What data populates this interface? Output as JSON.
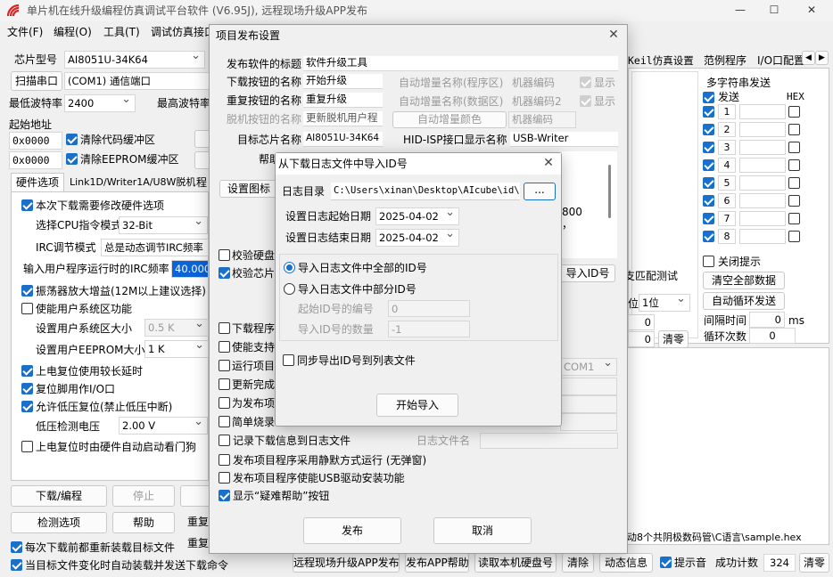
{
  "window": {
    "title": "单片机在线升级编程仿真调试平台软件 (V6.95J), 远程现场升级APP发布"
  },
  "menu": [
    "文件(F)",
    "编程(O)",
    "工具(T)",
    "调试仿真接口"
  ],
  "left": {
    "chip_label": "芯片型号",
    "chip_value": "AI8051U-34K64",
    "scan_btn": "扫描串口",
    "port_value": "(COM1) 通信端口",
    "min_baud_label": "最低波特率",
    "min_baud_value": "2400",
    "max_baud_label": "最高波特率",
    "start_addr_label": "起始地址",
    "addr1": "0x0000",
    "clear_code": "清除代码缓冲区",
    "addr2": "0x0000",
    "clear_eeprom": "清除EEPROM缓冲区",
    "tabs": [
      "硬件选项",
      "Link1D/Writer1A/U8W脱机",
      "程"
    ],
    "opt_modify_hw": "本次下载需要修改硬件选项",
    "cpu_mode_label": "选择CPU指令模式",
    "cpu_mode_value": "32-Bit",
    "irc_label": "IRC调节模式",
    "irc_value": "总是动态调节IRC频率",
    "irc_input_label": "输入用户程序运行时的IRC频率",
    "irc_input_value": "40.000",
    "osc_gain": "振荡器放大增益(12M以上建议选择)",
    "sys_area": "使能用户系统区功能",
    "sys_size_label": "设置用户系统区大小",
    "sys_size_value": "0.5 K",
    "eeprom_size_label": "设置用户EEPROM大小",
    "eeprom_size_value": "1 K",
    "long_delay": "上电复位使用较长延时",
    "reset_io": "复位脚用作I/O口",
    "lvd_reset": "允许低压复位(禁止低压中断)",
    "lvd_label": "低压检测电压",
    "lvd_value": "2.00 V",
    "wdt": "上电复位时由硬件自动启动看门狗",
    "download_btn": "下载/编程",
    "stop_btn": "停止",
    "check_btn": "检测选项",
    "help_btn": "帮助",
    "reload_each": "每次下载前都重新装载目标文件",
    "auto_reload": "当目标文件变化时自动装载并发送下载命令",
    "repeat1": "重复",
    "repeat2": "重复"
  },
  "right": {
    "tabs": [
      "Keil仿真设置",
      "范例程序",
      "I/O口配置"
    ],
    "serial_title": "多字符串发送",
    "send_header": "发送",
    "hex_header": "HEX",
    "rows": [
      "1",
      "2",
      "3",
      "4",
      "5",
      "6",
      "7",
      "8"
    ],
    "close_tip": "关闭提示",
    "clear_all_btn": "清空全部数据",
    "auto_loop_btn": "自动循环发送",
    "interval_label": "间隔时间",
    "interval_value": "0",
    "interval_unit": "ms",
    "loop_label": "循环次数",
    "loop_value": "0",
    "pos_label": "位",
    "pos_value": "1位",
    "clear_btn": "清零",
    "match_test": "支匹配测试",
    "com_value": "OM1",
    "hex_file": "动8个共阴极数码管\\C语言\\sample.hex",
    "counter_label": "成功计数",
    "counter_value": "324",
    "counter_clear": "清零",
    "sound_tip": "提示音"
  },
  "bottom_bar": [
    "远程现场升级APP发布",
    "发布APP帮助",
    "读取本机硬盘号",
    "清除",
    "动态信息"
  ],
  "publish_dialog": {
    "title": "项目发布设置",
    "app_title_label": "发布软件的标题",
    "app_title_value": "软件升级工具",
    "dl_btn_label": "下载按钮的名称",
    "dl_btn_value": "开始升级",
    "rpt_btn_label": "重复按钮的名称",
    "rpt_btn_value": "重复升级",
    "offline_label": "脱机按钮的名称",
    "offline_value": "更新脱机用户程",
    "chip_label": "目标芯片名称",
    "chip_value": "AI8051U-34K64",
    "auto_inc_prog": "自动增量名称(程序区)",
    "machine_code": "机器编码",
    "show1": "显示",
    "auto_inc_data": "自动增量名称(数据区)",
    "machine_code2": "机器编码2",
    "show2": "显示",
    "auto_inc_color": "自动增量颜色",
    "machine_code_field": "机器编码",
    "hid_label": "HID-ISP接口显示名称",
    "hid_value": "USB-Writer",
    "help_label": "帮助",
    "icon_btn": "设置图标",
    "text_tail1": "800",
    "text_tail2": "，",
    "checks": [
      "校验硬盘",
      "校验芯片",
      "下载程序",
      "使能支持",
      "运行项目",
      "更新完成",
      "为发布项",
      "简单烧录"
    ],
    "import_id_btn": "导入ID号",
    "log_check": "记录下载信息到日志文件",
    "log_name_label": "日志文件名",
    "silent_check": "发布项目程序采用静默方式运行 (无弹窗)",
    "usb_driver_check": "发布项目程序使能USB驱动安装功能",
    "help_check": "显示“疑难帮助”按钮",
    "publish_btn": "发布",
    "cancel_btn": "取消",
    "com_select": "COM1"
  },
  "import_dialog": {
    "title": "从下载日志文件中导入ID号",
    "log_dir_label": "日志目录",
    "log_dir_value": "C:\\Users\\xinan\\Desktop\\AIcube\\id\\s",
    "browse_btn": "...",
    "start_date_label": "设置日志起始日期",
    "start_date": "2025-04-02",
    "end_date_label": "设置日志结束日期",
    "end_date": "2025-04-02",
    "import_all": "导入日志文件中全部的ID号",
    "import_part": "导入日志文件中部分ID号",
    "start_id_label": "起始ID号的编号",
    "start_id_value": "0",
    "count_label": "导入ID号的数量",
    "count_value": "-1",
    "sync_export": "同步导出ID号到列表文件",
    "start_btn": "开始导入"
  }
}
